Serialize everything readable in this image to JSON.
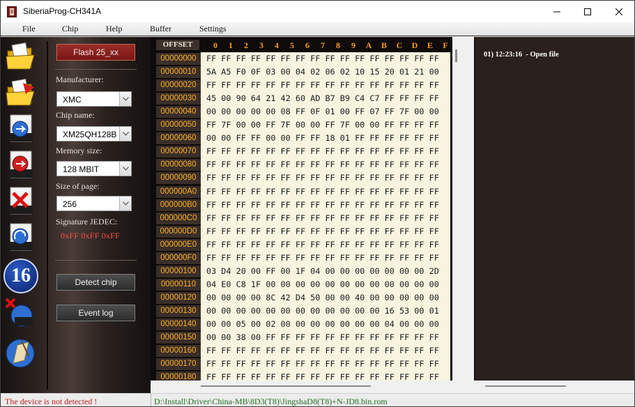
{
  "window": {
    "title": "SiberiaProg-CH341A"
  },
  "menu": [
    "File",
    "Chip",
    "Help",
    "Buffer",
    "Settings"
  ],
  "toolbar": {
    "icons": [
      "open-file-icon",
      "save-file-icon",
      "read-chip-icon",
      "write-chip-icon",
      "erase-chip-icon",
      "verify-chip-icon",
      "hex-16-icon",
      "blank-check-icon",
      "auto-program-icon"
    ],
    "badge_16": "16"
  },
  "chip_panel": {
    "flash_button": "Flash 25_xx",
    "manufacturer_label": "Manufacturer:",
    "manufacturer_value": "XMC",
    "chip_name_label": "Chip name:",
    "chip_name_value": "XM25QH128B",
    "memory_size_label": "Memory size:",
    "memory_size_value": "128 MBIT",
    "page_size_label": "Size of page:",
    "page_size_value": "256",
    "jedec_label": "Signature JEDEC:",
    "jedec_value": "0xFF  0xFF  0xFF",
    "detect_button": "Detect chip",
    "event_log_button": "Event log"
  },
  "hex": {
    "offset_title": "OFFSET",
    "columns": [
      "0",
      "1",
      "2",
      "3",
      "4",
      "5",
      "6",
      "7",
      "8",
      "9",
      "A",
      "B",
      "C",
      "D",
      "E",
      "F"
    ],
    "offsets": [
      "00000000",
      "00000010",
      "00000020",
      "00000030",
      "00000040",
      "00000050",
      "00000060",
      "00000070",
      "00000080",
      "00000090",
      "000000A0",
      "000000B0",
      "000000C0",
      "000000D0",
      "000000E0",
      "000000F0",
      "00000100",
      "00000110",
      "00000120",
      "00000130",
      "00000140",
      "00000150",
      "00000160",
      "00000170",
      "00000180"
    ],
    "rows": [
      "FF FF FF FF FF FF FF FF FF FF FF FF FF FF FF FF",
      "5A A5 F0 0F 03 00 04 02 06 02 10 15 20 01 21 00",
      "FF FF FF FF FF FF FF FF FF FF FF FF FF FF FF FF",
      "45 00 90 64 21 42 60 AD B7 B9 C4 C7 FF FF FF FF",
      "00 00 00 00 00 08 FF 0F 01 00 FF 07 FF 7F 00 00",
      "FF 7F 00 00 FF 7F 00 00 FF 7F 00 00 FF FF FF FF",
      "00 00 FF FF 00 00 FF FF 18 01 FF FF FF FF FF FF",
      "FF FF FF FF FF FF FF FF FF FF FF FF FF FF FF FF",
      "FF FF FF FF FF FF FF FF FF FF FF FF FF FF FF FF",
      "FF FF FF FF FF FF FF FF FF FF FF FF FF FF FF FF",
      "FF FF FF FF FF FF FF FF FF FF FF FF FF FF FF FF",
      "FF FF FF FF FF FF FF FF FF FF FF FF FF FF FF FF",
      "FF FF FF FF FF FF FF FF FF FF FF FF FF FF FF FF",
      "FF FF FF FF FF FF FF FF FF FF FF FF FF FF FF FF",
      "FF FF FF FF FF FF FF FF FF FF FF FF FF FF FF FF",
      "FF FF FF FF FF FF FF FF FF FF FF FF FF FF FF FF",
      "03 D4 20 00 FF 00 1F 04 00 00 00 00 00 00 00 2D",
      "04 E0 C8 1F 00 00 00 00 00 00 00 00 00 00 00 00",
      "00 00 00 00 8C 42 D4 50 00 00 40 00 00 00 00 00",
      "00 00 00 00 00 00 00 00 00 00 00 00 16 53 00 01",
      "00 00 05 00 02 00 00 00 00 00 00 00 04 00 00 00",
      "00 00 38 00 FF FF FF FF FF FF FF FF FF FF FF FF",
      "FF FF FF FF FF FF FF FF FF FF FF FF FF FF FF FF",
      "FF FF FF FF FF FF FF FF FF FF FF FF FF FF FF FF",
      "FF FF FF FF FF FF FF FF FF FF FF FF FF FF FF FF"
    ]
  },
  "log": {
    "entries": [
      "01) 12:23:16  - Open file"
    ]
  },
  "status": {
    "device": "The device is not detected !",
    "file_path": "D:\\Install\\Driver\\China-MB\\8D3(T8)\\JingshaD8(T8)+N-JD8.bin.rom"
  }
}
